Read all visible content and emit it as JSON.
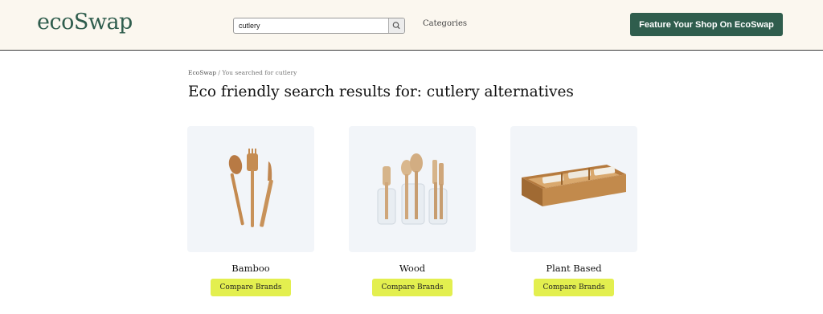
{
  "header": {
    "logo_text": "ecoSwap",
    "search_value": "cutlery",
    "search_icon": "search-icon",
    "categories_label": "Categories",
    "feature_button_label": "Feature Your Shop On EcoSwap"
  },
  "breadcrumb": {
    "home": "EcoSwap",
    "separator": " / ",
    "current": "You searched for cutlery"
  },
  "page_title": "Eco friendly search results for: cutlery alternatives",
  "products": [
    {
      "name": "Bamboo",
      "button_label": "Compare Brands",
      "icon": "bamboo-cutlery-image"
    },
    {
      "name": "Wood",
      "button_label": "Compare Brands",
      "icon": "wood-cutlery-image"
    },
    {
      "name": "Plant Based",
      "button_label": "Compare Brands",
      "icon": "plant-based-cutlery-image"
    }
  ],
  "colors": {
    "brand_green": "#2f5d4d",
    "header_bg": "#fbf7ef",
    "button_yellow": "#e3ef4f",
    "card_bg": "#f2f5f9"
  }
}
